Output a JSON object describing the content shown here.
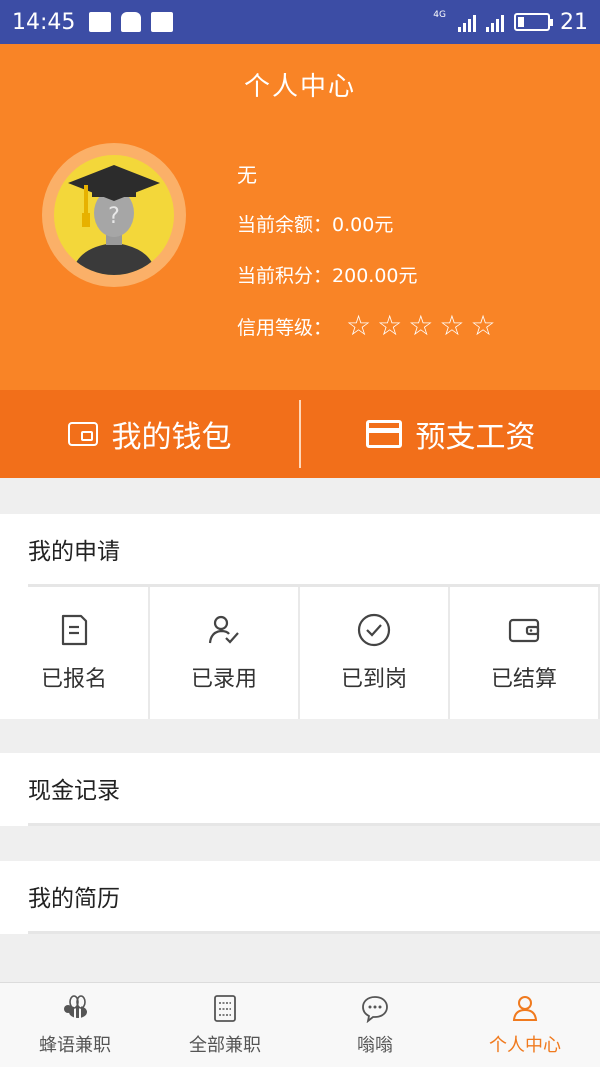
{
  "status_bar": {
    "time": "14:45",
    "network_tag": "4G",
    "battery": "21"
  },
  "header": {
    "title": "个人中心",
    "name": "无",
    "balance_label": "当前余额：",
    "balance_value": "0.00元",
    "points_label": "当前积分：",
    "points_value": "200.00元",
    "credit_label": "信用等级：",
    "credit_stars": 5
  },
  "actions": {
    "wallet": "我的钱包",
    "advance_salary": "预支工资"
  },
  "my_applications": {
    "title": "我的申请",
    "items": [
      {
        "label": "已报名",
        "icon": "document-icon"
      },
      {
        "label": "已录用",
        "icon": "user-check-icon"
      },
      {
        "label": "已到岗",
        "icon": "check-circle-icon"
      },
      {
        "label": "已结算",
        "icon": "wallet-icon"
      }
    ]
  },
  "cash_records": {
    "title": "现金记录"
  },
  "my_resume": {
    "title": "我的简历"
  },
  "tabbar": {
    "items": [
      {
        "label": "蜂语兼职",
        "icon": "bee-icon",
        "active": false
      },
      {
        "label": "全部兼职",
        "icon": "list-doc-icon",
        "active": false
      },
      {
        "label": "嗡嗡",
        "icon": "chat-bubble-icon",
        "active": false
      },
      {
        "label": "个人中心",
        "icon": "person-icon",
        "active": true
      }
    ]
  },
  "colors": {
    "header_orange": "#f98426",
    "action_orange": "#f26f1a",
    "active_tab": "#f07a1e",
    "status_bar": "#3c4da5"
  }
}
